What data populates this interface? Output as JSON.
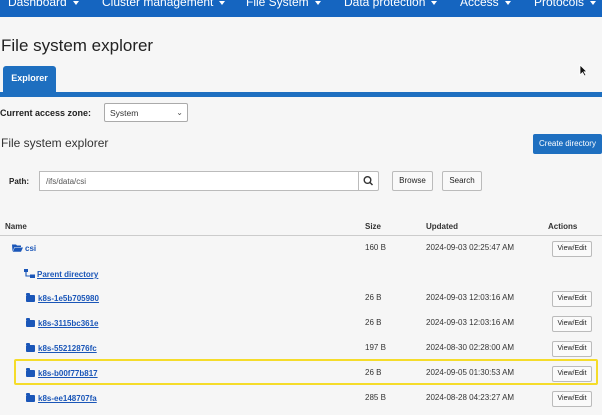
{
  "nav": {
    "items": [
      "Dashboard",
      "Cluster management",
      "File System",
      "Data protection",
      "Access",
      "Protocols"
    ]
  },
  "page": {
    "title": "File system explorer",
    "tab_label": "Explorer"
  },
  "access_zone": {
    "label": "Current access zone:",
    "selected": "System"
  },
  "section": {
    "title": "File system explorer",
    "create_button": "Create directory"
  },
  "path": {
    "label": "Path:",
    "value": "/ifs/data/csi",
    "browse": "Browse",
    "search": "Search"
  },
  "table": {
    "headers": {
      "name": "Name",
      "size": "Size",
      "updated": "Updated",
      "actions": "Actions"
    },
    "rows": [
      {
        "name": "csi",
        "size": "160 B",
        "updated": "2024-09-03 02:25:47 AM",
        "action": "View/Edit"
      },
      {
        "name": "Parent directory",
        "size": "",
        "updated": "",
        "action": ""
      },
      {
        "name": "k8s-1e5b705980",
        "size": "26 B",
        "updated": "2024-09-03 12:03:16 AM",
        "action": "View/Edit"
      },
      {
        "name": "k8s-3115bc361e",
        "size": "26 B",
        "updated": "2024-09-03 12:03:16 AM",
        "action": "View/Edit"
      },
      {
        "name": "k8s-55212876fc",
        "size": "197 B",
        "updated": "2024-08-30 02:28:00 AM",
        "action": "View/Edit"
      },
      {
        "name": "k8s-b00f77b817",
        "size": "26 B",
        "updated": "2024-09-05 01:30:53 AM",
        "action": "View/Edit"
      },
      {
        "name": "k8s-ee148707fa",
        "size": "285 B",
        "updated": "2024-08-28 04:23:27 AM",
        "action": "View/Edit"
      }
    ]
  },
  "colors": {
    "accent": "#1e6fc0",
    "link": "#1a56b8",
    "highlight": "#f5dc2a"
  }
}
